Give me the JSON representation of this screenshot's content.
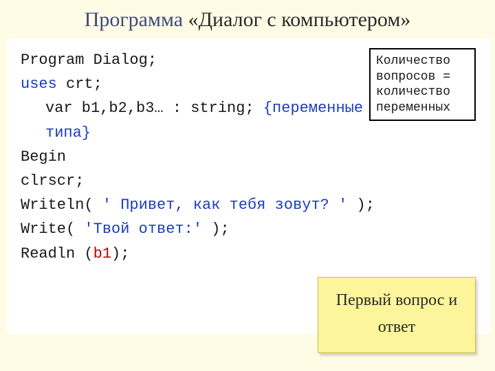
{
  "title": {
    "word1": "Программа",
    "word2": "«Диалог с компьютером»"
  },
  "code": {
    "line1": "Program Dialog;",
    "line2a": "uses",
    "line2b": " crt;",
    "line3a": "var b1,b2,b3… : string; ",
    "line3b": "{переменные строкового типа}",
    "line4": "Begin",
    "line5": "clrscr;",
    "line6a": "Writeln(",
    "line6b": " ' Привет, как тебя зовут? ' ",
    "line6c": ");",
    "line7a": "Write( ",
    "line7b": "'Твой ответ:'",
    "line7c": " );",
    "line8a": "Readln (",
    "line8b": "b1",
    "line8c": ");"
  },
  "note": "Количество вопросов = количество переменных",
  "callout": "Первый вопрос и ответ"
}
